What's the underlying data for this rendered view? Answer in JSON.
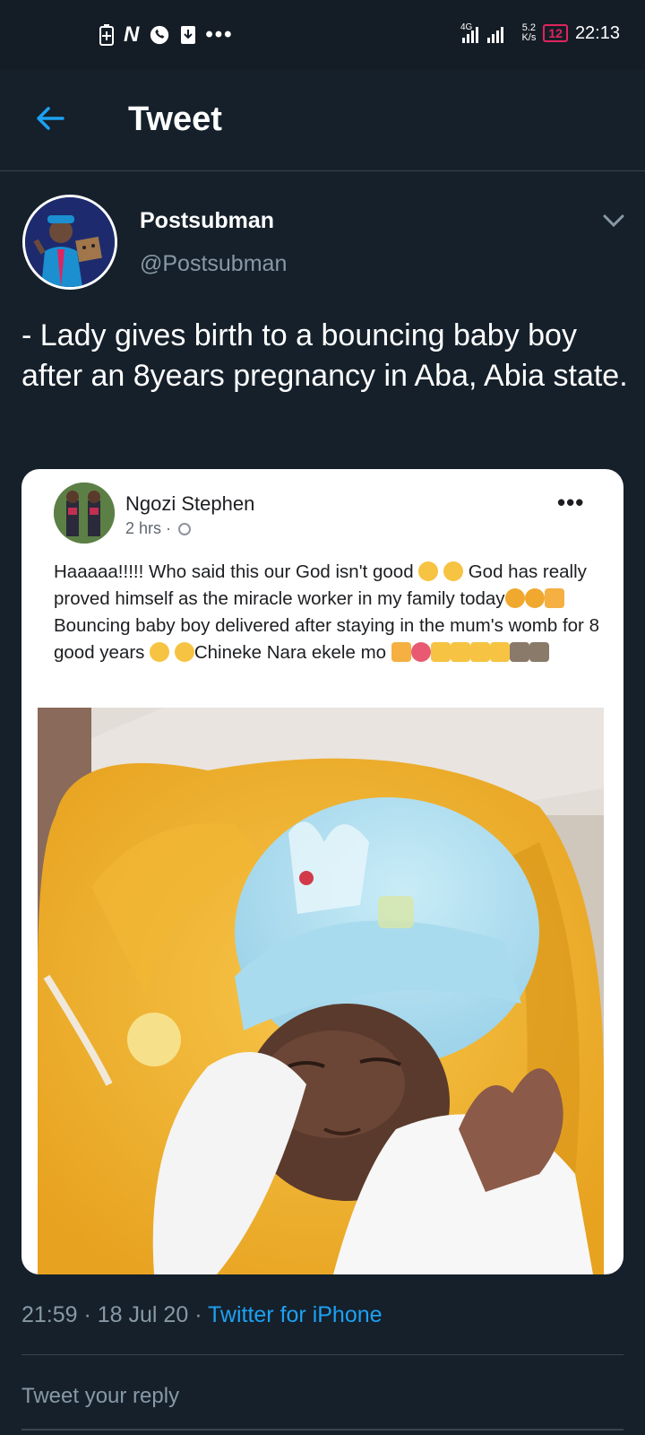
{
  "status_bar": {
    "network": "4G",
    "speed_value": "5.2",
    "speed_unit": "K/s",
    "battery": "12",
    "time": "22:13"
  },
  "header": {
    "title": "Tweet",
    "back_icon": "arrow-left-icon"
  },
  "tweet": {
    "author_name": "Postsubman",
    "author_handle": "@Postsubman",
    "text": "- Lady gives birth to a bouncing baby boy after an 8years pregnancy in Aba, Abia state.",
    "timestamp": "21:59 · 18 Jul 20 · ",
    "source": "Twitter for iPhone"
  },
  "embedded_post": {
    "name": "Ngozi Stephen",
    "time": "2 hrs · ",
    "more": "•••",
    "text_line1": "Haaaaa!!!!! Who said this our God isn't good ",
    "text_line2": "God has really proved himself as the miracle worker in my family today",
    "text_line3": "Bouncing baby boy delivered after staying in the mum's womb for 8 good years ",
    "text_line4": "Chineke Nara ekele mo "
  },
  "reply": {
    "placeholder": "Tweet your reply"
  },
  "colors": {
    "background": "#15202b",
    "accent": "#1da1f2",
    "secondary_text": "#8899a6",
    "battery_low": "#e0245e"
  }
}
